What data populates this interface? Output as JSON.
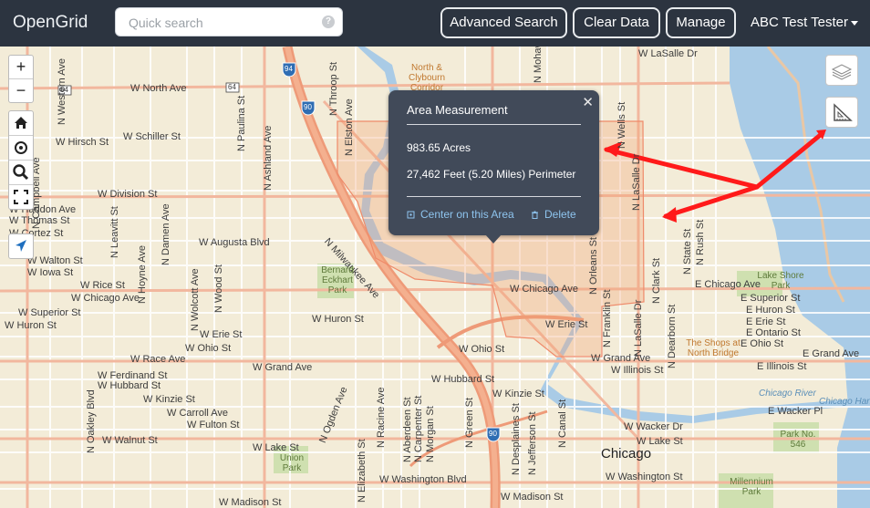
{
  "app": {
    "title": "OpenGrid"
  },
  "search": {
    "placeholder": "Quick search",
    "help_symbol": "?"
  },
  "nav": {
    "advanced_search": "Advanced Search",
    "clear_data": "Clear Data",
    "manage": "Manage",
    "user": "ABC Test Tester"
  },
  "map_controls": {
    "zoom_in": "+",
    "zoom_out": "−"
  },
  "popup": {
    "title": "Area Measurement",
    "close": "✕",
    "acres": "983.65 Acres",
    "perimeter": "27,462 Feet (5.20 Miles) Perimeter",
    "center_link": "Center on this Area",
    "delete_link": "Delete"
  },
  "colors": {
    "topbar": "#2c3440",
    "popup": "#414a59",
    "link": "#8ec4ee",
    "arrow": "#ff1a1a",
    "lake": "#a9cbe6",
    "measure_fill": "#f3a274"
  },
  "map_labels": {
    "streets": {
      "north_ave": "W North Ave",
      "schiller": "W Schiller St",
      "hirsch": "W Hirsch St",
      "division": "W Division St",
      "haddon": "W Haddon Ave",
      "thomas": "W Thomas St",
      "cortez": "W Cortez St",
      "augusta": "W Augusta Blvd",
      "walton": "W Walton St",
      "iowa": "W Iowa St",
      "rice": "W Rice St",
      "chicago_w": "W Chicago Ave",
      "superior_w": "W Superior St",
      "huron_w": "W Huron St",
      "erie_w": "W Erie St",
      "ohio_w": "W Ohio St",
      "race": "W Race Ave",
      "ferdinand": "W Ferdinand St",
      "hubbard_w": "W Hubbard St",
      "grand_w": "W Grand Ave",
      "kinzie_w": "W Kinzie St",
      "carroll": "W Carroll Ave",
      "fulton": "W Fulton St",
      "walnut": "W Walnut St",
      "lake_w": "W Lake St",
      "washington": "W Washington Blvd",
      "madison": "W Madison St",
      "chicago_mid": "W Chicago Ave",
      "erie_mid": "W Erie St",
      "ohio_mid": "W Ohio St",
      "hubbard_mid": "W Hubbard St",
      "kinzie_mid": "W Kinzie St",
      "grand_mid": "W Grand Ave",
      "illinois_mid": "W Illinois St",
      "wacker": "W Wacker Dr",
      "lake_e": "W Lake St",
      "washington_e": "W Washington St",
      "madison_e": "W Madison St",
      "lake_shore": "Lake Shore Park",
      "chicago_e": "E Chicago Ave",
      "superior_e": "E Superior St",
      "huron_e": "E Huron St",
      "erie_e": "E Erie St",
      "ontario_e": "E Ontario St",
      "ohio_e": "E Ohio St",
      "grand_e": "E Grand Ave",
      "illinois_e": "E Illinois St",
      "wacker_e": "E Wacker Pl",
      "lasalle_dr": "W LaSalle Dr",
      "western": "N Western Ave",
      "campbell": "N Campbell Ave",
      "leavitt": "N Leavitt St",
      "hoyne": "N Hoyne Ave",
      "damen": "N Damen Ave",
      "wolcott": "N Wolcott Ave",
      "wood": "N Wood St",
      "paulina": "N Paulina St",
      "ashland": "N Ashland Ave",
      "throop": "N Throop St",
      "elston": "N Elston Ave",
      "milwaukee": "N Milwaukee Ave",
      "ogden": "N Ogden Ave",
      "oakley": "N Oakley Blvd",
      "elizabeth": "N Elizabeth St",
      "racine": "N Racine Ave",
      "aberdeen": "N Aberdeen St",
      "carpenter": "N Carpenter St",
      "morgan": "N Morgan St",
      "green": "N Green St",
      "desplaines": "N Desplaines St",
      "jefferson": "N Jefferson St",
      "canal": "N Canal St",
      "orleans": "N Orleans St",
      "franklin": "N Franklin St",
      "wells": "N Wells St",
      "lasalle": "N LaSalle Dr",
      "clark": "N Clark St",
      "dearborn": "N Dearborn St",
      "state": "N State St",
      "rush": "N Rush St",
      "mohawk": "N Mohawk"
    },
    "city": "Chicago",
    "parks": {
      "bernard": "Bernard Eckhart Park",
      "union": "Union Park",
      "park546": "Park No. 546",
      "millennium": "Millennium Park"
    },
    "poi": {
      "clybourn": "North & Clybourn Corridor",
      "shops": "The Shops at North Bridge"
    },
    "water": {
      "river": "Chicago River",
      "harbor": "Chicago Harb"
    },
    "shields": {
      "i94": "94",
      "i90a": "90",
      "i90b": "90",
      "us64a": "64",
      "us64b": "64"
    }
  }
}
